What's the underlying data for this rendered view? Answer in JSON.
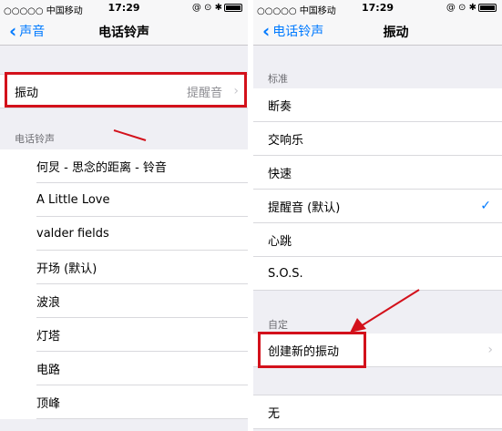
{
  "left": {
    "status": {
      "carrier": "○○○○○ 中国移动",
      "time": "17:29",
      "icons": "@ ⊙ ✱"
    },
    "navbar": {
      "back_label": "声音",
      "title": "电话铃声"
    },
    "vibration_row": {
      "label": "振动",
      "value": "提醒音"
    },
    "section_header": "电话铃声",
    "ringtones": [
      "何炅 - 思念的距离 - 铃音",
      "A Little Love",
      "valder fields",
      "开场 (默认)",
      "波浪",
      "灯塔",
      "电路",
      "顶峰"
    ]
  },
  "right": {
    "status": {
      "carrier": "○○○○○ 中国移动",
      "time": "17:29",
      "icons": "@ ⊙ ✱"
    },
    "navbar": {
      "back_label": "电话铃声",
      "title": "振动"
    },
    "standard_header": "标准",
    "standard_items": [
      {
        "label": "断奏",
        "checked": false
      },
      {
        "label": "交响乐",
        "checked": false
      },
      {
        "label": "快速",
        "checked": false
      },
      {
        "label": "提醒音 (默认)",
        "checked": true
      },
      {
        "label": "心跳",
        "checked": false
      },
      {
        "label": "S.O.S.",
        "checked": false
      }
    ],
    "custom_header": "自定",
    "create_label": "创建新的振动",
    "none_label": "无"
  },
  "colors": {
    "accent": "#007aff",
    "highlight": "#d3111b",
    "background": "#efeff4"
  }
}
